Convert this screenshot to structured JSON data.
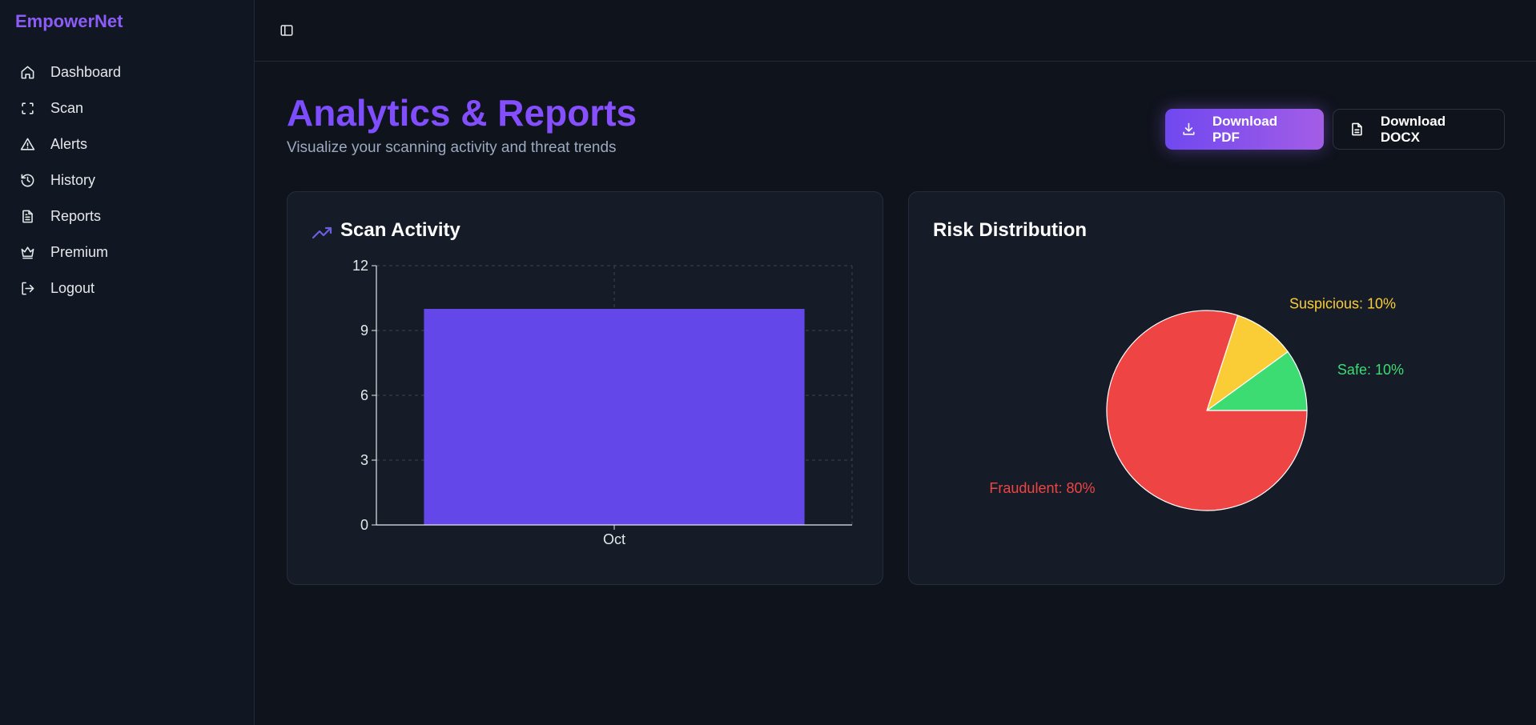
{
  "app": {
    "brand": "EmpowerNet"
  },
  "sidebar": {
    "items": [
      {
        "label": "Dashboard",
        "icon": "home-icon"
      },
      {
        "label": "Scan",
        "icon": "scan-icon"
      },
      {
        "label": "Alerts",
        "icon": "alert-triangle-icon"
      },
      {
        "label": "History",
        "icon": "history-icon"
      },
      {
        "label": "Reports",
        "icon": "document-icon"
      },
      {
        "label": "Premium",
        "icon": "crown-icon"
      },
      {
        "label": "Logout",
        "icon": "logout-icon"
      }
    ]
  },
  "header": {
    "title": "Analytics & Reports",
    "subtitle": "Visualize your scanning activity and threat trends",
    "download_pdf_label": "Download PDF",
    "download_docx_label": "Download DOCX"
  },
  "colors": {
    "accent": "#6646e8",
    "bar": "#6447e8",
    "fraudulent": "#ef4444",
    "suspicious": "#facc35",
    "safe": "#3ddc73"
  },
  "chart_data": [
    {
      "type": "bar",
      "title": "Scan Activity",
      "categories": [
        "Oct"
      ],
      "values": [
        10
      ],
      "ylim": [
        0,
        12
      ],
      "yticks": [
        0,
        3,
        6,
        9,
        12
      ],
      "grid": true
    },
    {
      "type": "pie",
      "title": "Risk Distribution",
      "slices": [
        {
          "name": "Fraudulent",
          "value": 80,
          "label": "Fraudulent: 80%"
        },
        {
          "name": "Suspicious",
          "value": 10,
          "label": "Suspicious: 10%"
        },
        {
          "name": "Safe",
          "value": 10,
          "label": "Safe: 10%"
        }
      ]
    }
  ]
}
